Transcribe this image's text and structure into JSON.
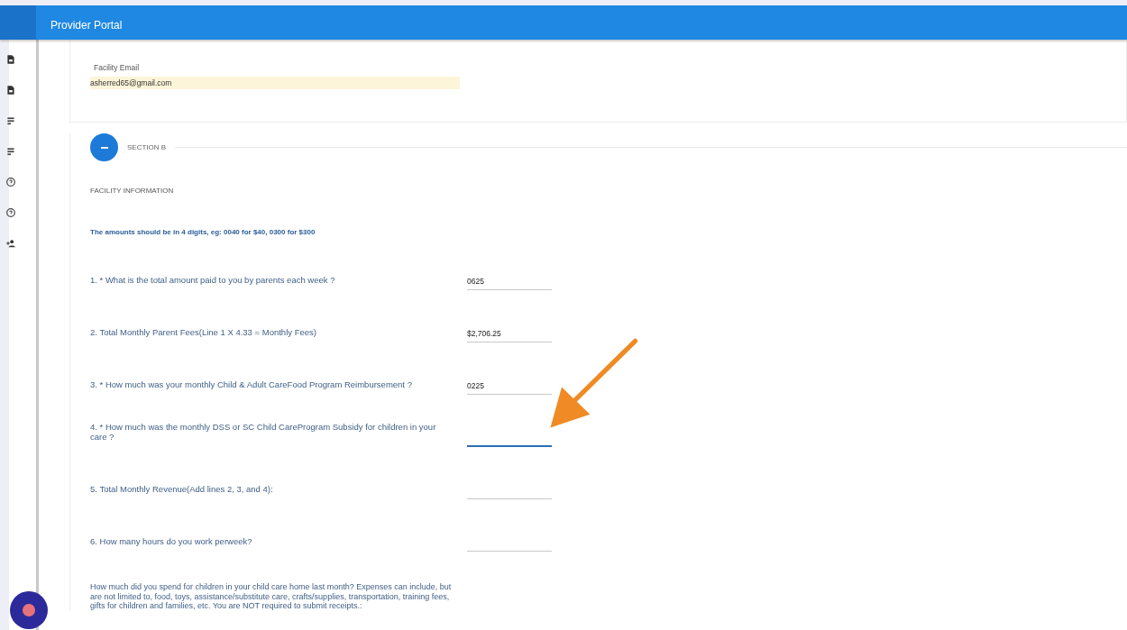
{
  "header": {
    "title": "Provider Portal"
  },
  "email_field": {
    "label": "Facility Email",
    "value": "asherred65@gmail.com",
    "autofilled": true
  },
  "section": {
    "label": "SECTION B",
    "expanded": true
  },
  "subheading": "FACILITY INFORMATION",
  "note": "The amounts should be in 4 digits, eg: 0040 for $40, 0300 for $300",
  "questions": [
    {
      "label": "1. * What is the total amount paid to you by parents each week ?",
      "value": "0625",
      "focused": false
    },
    {
      "label": "2. Total Monthly Parent Fees(Line 1 X 4.33 = Monthly Fees)",
      "value": "$2,706.25",
      "focused": false
    },
    {
      "label": "3. * How much was your monthly Child & Adult CareFood Program Reimbursement ?",
      "value": "0225",
      "focused": false
    },
    {
      "label": "4. * How much was the monthly DSS or SC Child CareProgram Subsidy for children in your care ?",
      "focused": true
    },
    {
      "label": "5. Total Monthly Revenue(Add lines 2, 3, and 4):",
      "focused": false
    },
    {
      "label": "6. How many hours do you work perweek?",
      "focused": false
    }
  ],
  "expenses_text": "How much did you spend for children in your child care home last month? Expenses can include, but are not limited to, food, toys, assistance/substitute care, crafts/supplies, transportation, training fees, gifts for children and families, etc. You are NOT required to submit receipts.:"
}
